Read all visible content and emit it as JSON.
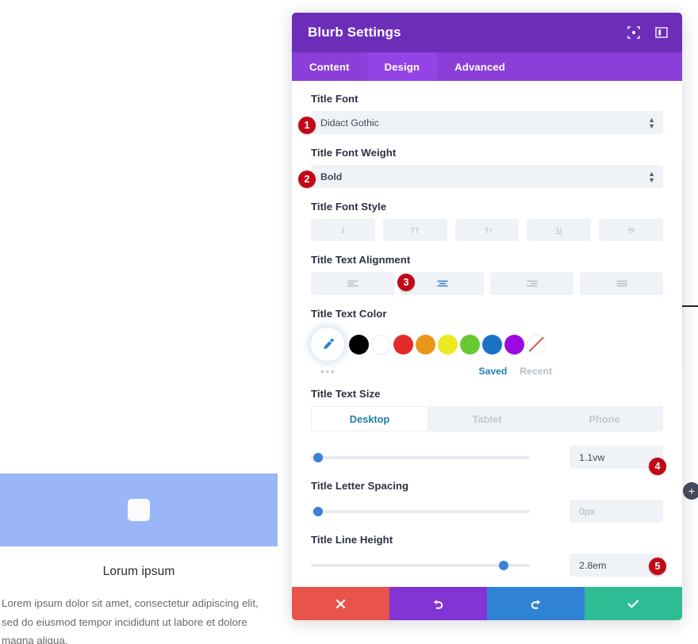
{
  "preview": {
    "blurb_title": "Lorum ipsum",
    "blurb_body": "Lorem ipsum dolor sit amet, consectetur adipiscing elit, sed do eiusmod tempor incididunt ut labore et dolore magna aliqua.",
    "image_color": "#9ab6f7"
  },
  "modal": {
    "title": "Blurb Settings",
    "header_icons": [
      {
        "name": "fullscreen-icon"
      },
      {
        "name": "layout-toggle-icon"
      }
    ],
    "tabs": [
      {
        "label": "Content",
        "active": false
      },
      {
        "label": "Design",
        "active": true
      },
      {
        "label": "Advanced",
        "active": false
      }
    ],
    "accent_purple": "#6c2eb9",
    "tabbar_purple": "#8c3fd8",
    "active_tab_purple": "#9443e6"
  },
  "fields": {
    "title_font": {
      "label": "Title Font",
      "value": "Didact Gothic",
      "badge": "1"
    },
    "title_font_weight": {
      "label": "Title Font Weight",
      "value": "Bold",
      "badge": "2"
    },
    "title_font_style": {
      "label": "Title Font Style",
      "buttons": [
        {
          "name": "italic-icon",
          "glyph": "I"
        },
        {
          "name": "uppercase-icon",
          "glyph": "TT"
        },
        {
          "name": "small-caps-icon",
          "glyph": "TT"
        },
        {
          "name": "underline-icon",
          "glyph": "U"
        },
        {
          "name": "strikethrough-icon",
          "glyph": "S"
        }
      ]
    },
    "title_text_alignment": {
      "label": "Title Text Alignment",
      "badge": "3",
      "options": [
        {
          "name": "align-left-icon",
          "active": false
        },
        {
          "name": "align-center-icon",
          "active": true
        },
        {
          "name": "align-right-icon",
          "active": false
        },
        {
          "name": "align-justify-icon",
          "active": false
        }
      ]
    },
    "title_text_color": {
      "label": "Title Text Color",
      "picker_icon": "eyedropper-icon",
      "more_dots": "•••",
      "saved_label": "Saved",
      "recent_label": "Recent",
      "swatches": [
        {
          "name": "swatch-black",
          "color": "#000000"
        },
        {
          "name": "swatch-white",
          "color": "#ffffff"
        },
        {
          "name": "swatch-red",
          "color": "#e42b2b"
        },
        {
          "name": "swatch-orange",
          "color": "#e8971a"
        },
        {
          "name": "swatch-yellow",
          "color": "#edea1f"
        },
        {
          "name": "swatch-green",
          "color": "#67c933"
        },
        {
          "name": "swatch-blue",
          "color": "#1b71c4"
        },
        {
          "name": "swatch-purple",
          "color": "#9b0ae0"
        },
        {
          "name": "swatch-none",
          "color": "transparent"
        }
      ]
    },
    "title_text_size": {
      "label": "Title Text Size",
      "devices": [
        {
          "label": "Desktop",
          "active": true
        },
        {
          "label": "Tablet",
          "active": false
        },
        {
          "label": "Phone",
          "active": false
        }
      ],
      "value": "1.1vw",
      "badge": "4",
      "slider_percent": 2
    },
    "title_letter_spacing": {
      "label": "Title Letter Spacing",
      "value": "",
      "placeholder": "0px",
      "slider_percent": 2
    },
    "title_line_height": {
      "label": "Title Line Height",
      "value": "2.8em",
      "badge": "5",
      "slider_percent": 88
    }
  },
  "footer": {
    "buttons": [
      {
        "name": "cancel-button",
        "icon": "close-icon",
        "color": "#e8544a"
      },
      {
        "name": "undo-button",
        "icon": "undo-icon",
        "color": "#8334d4"
      },
      {
        "name": "redo-button",
        "icon": "redo-icon",
        "color": "#3083d4"
      },
      {
        "name": "save-button",
        "icon": "check-icon",
        "color": "#2fbd96"
      }
    ]
  },
  "rail": {
    "add_button_label": "+"
  }
}
